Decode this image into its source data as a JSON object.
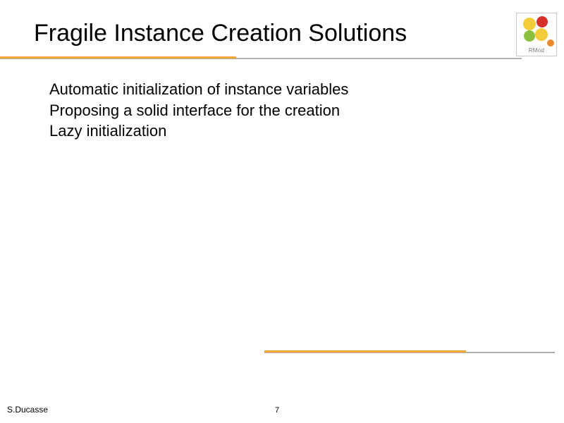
{
  "title": "Fragile Instance Creation Solutions",
  "body": {
    "line1": "Automatic initialization of instance variables",
    "line2": "Proposing a solid interface for the creation",
    "line3": "Lazy initialization"
  },
  "footer": {
    "author": "S.Ducasse",
    "page": "7"
  },
  "logo": {
    "label": "RMod",
    "colors": {
      "yellow": "#f3cc3a",
      "red": "#d7302a",
      "green": "#8bbf3d",
      "orange": "#e88b2e"
    }
  }
}
